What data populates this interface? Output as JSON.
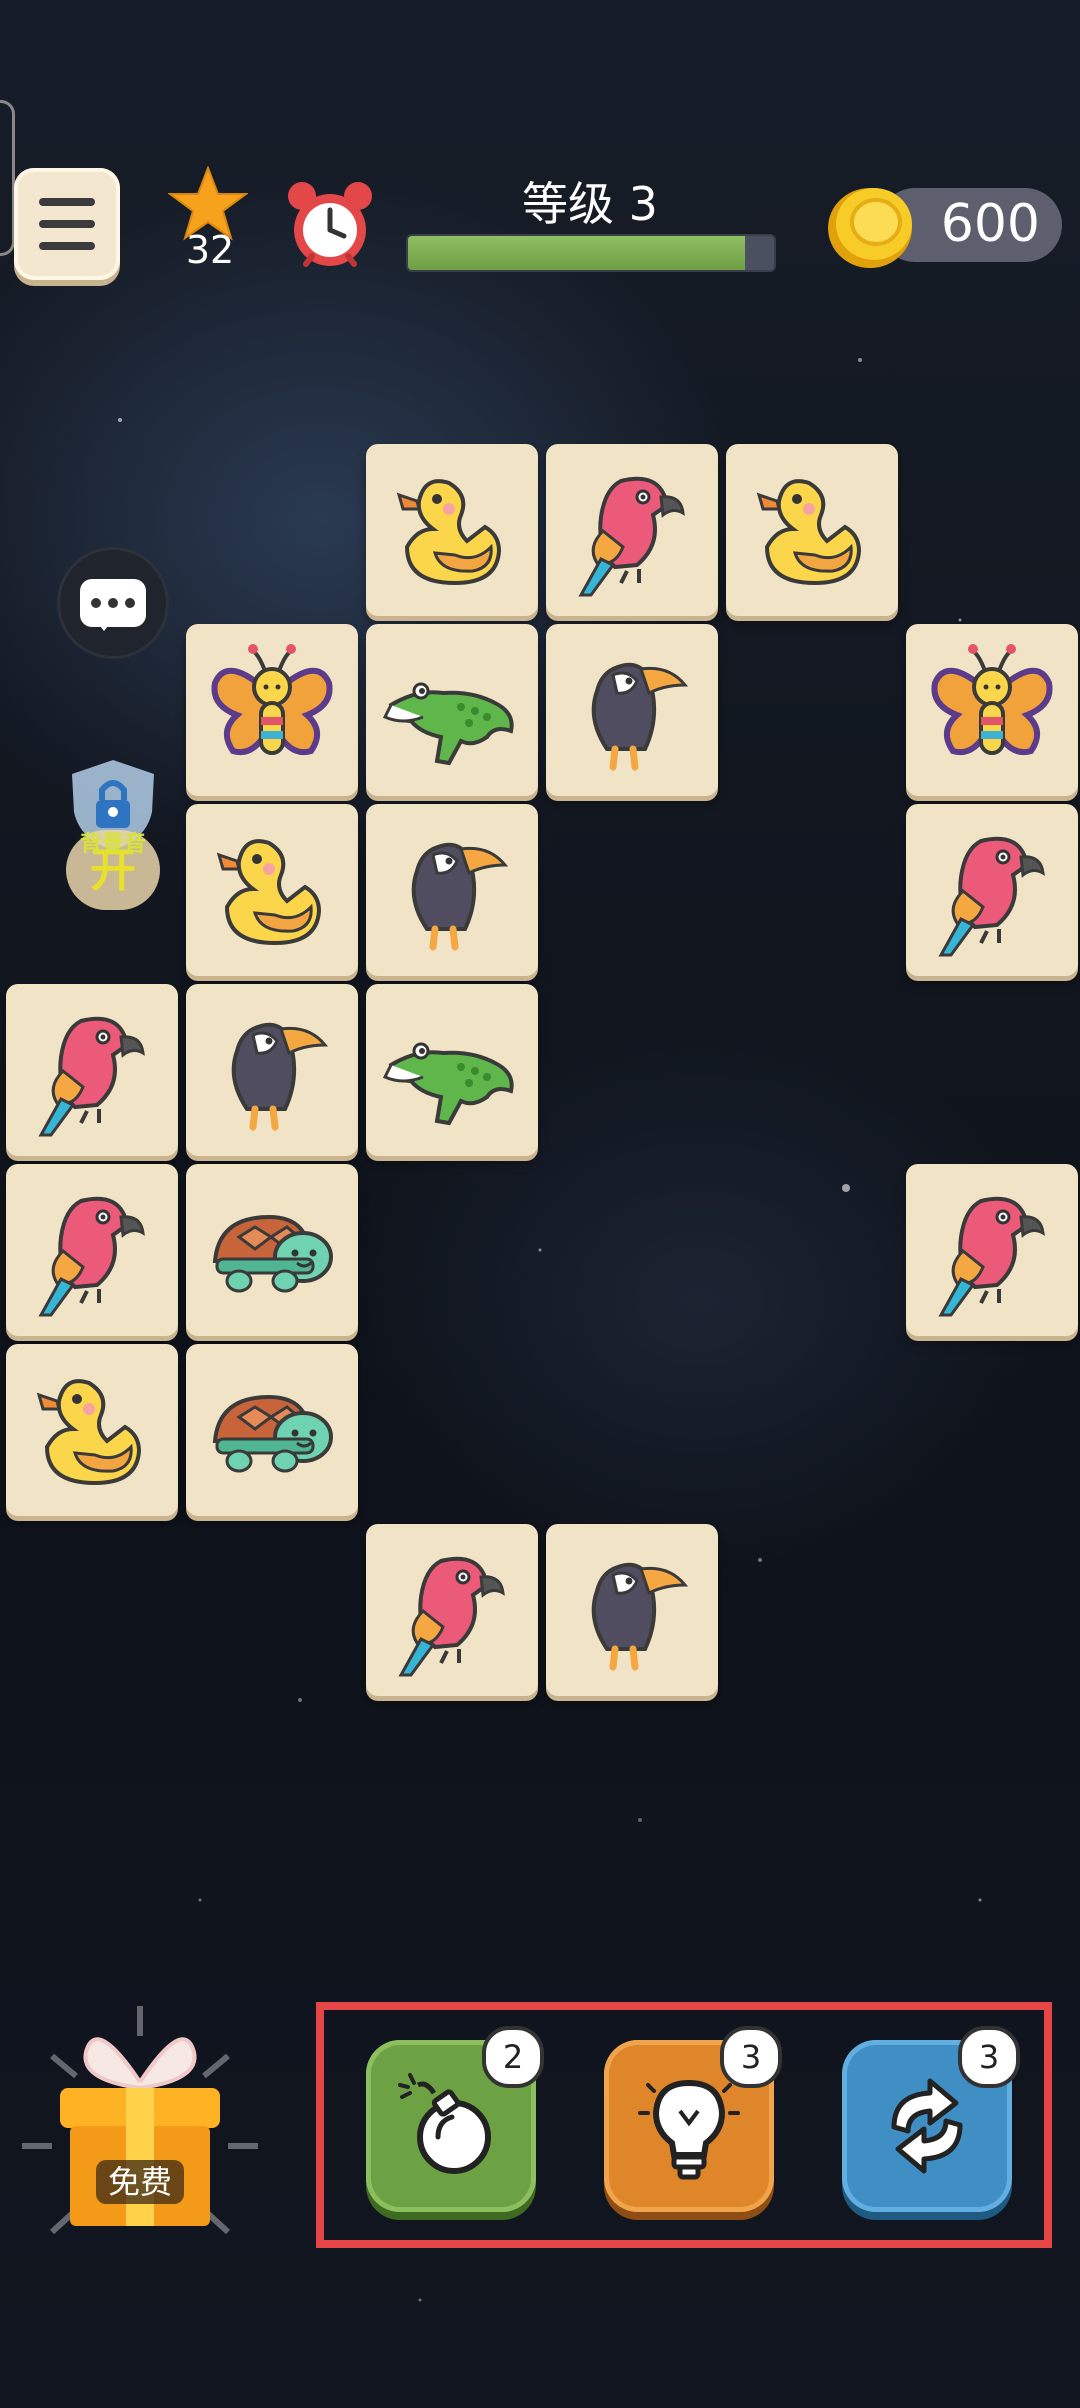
{
  "topbar": {
    "stars": "32",
    "level_title": "等级 3",
    "level_progress": 0.92,
    "coins": "600"
  },
  "side": {
    "bgm_label": "背景音",
    "bgm_toggle": "开"
  },
  "tiles": [
    {
      "row": 0,
      "col": 2,
      "animal": "duck"
    },
    {
      "row": 0,
      "col": 3,
      "animal": "parrot"
    },
    {
      "row": 0,
      "col": 4,
      "animal": "duck"
    },
    {
      "row": 1,
      "col": 1,
      "animal": "butterfly"
    },
    {
      "row": 1,
      "col": 2,
      "animal": "crocodile"
    },
    {
      "row": 1,
      "col": 3,
      "animal": "toucan"
    },
    {
      "row": 1,
      "col": 5,
      "animal": "butterfly"
    },
    {
      "row": 2,
      "col": 1,
      "animal": "duck"
    },
    {
      "row": 2,
      "col": 2,
      "animal": "toucan"
    },
    {
      "row": 2,
      "col": 5,
      "animal": "parrot"
    },
    {
      "row": 3,
      "col": 0,
      "animal": "parrot"
    },
    {
      "row": 3,
      "col": 1,
      "animal": "toucan"
    },
    {
      "row": 3,
      "col": 2,
      "animal": "crocodile"
    },
    {
      "row": 4,
      "col": 0,
      "animal": "parrot"
    },
    {
      "row": 4,
      "col": 1,
      "animal": "turtle"
    },
    {
      "row": 4,
      "col": 5,
      "animal": "parrot"
    },
    {
      "row": 5,
      "col": 0,
      "animal": "duck"
    },
    {
      "row": 5,
      "col": 1,
      "animal": "turtle"
    },
    {
      "row": 6,
      "col": 2,
      "animal": "parrot"
    },
    {
      "row": 6,
      "col": 3,
      "animal": "toucan"
    }
  ],
  "tools": {
    "bomb_count": "2",
    "hint_count": "3",
    "shuffle_count": "3"
  },
  "gift": {
    "label": "免费"
  },
  "colors": {
    "tile": "#f0e3c6",
    "bomb": "#6da244",
    "hint": "#e0862a",
    "shuffle": "#3f8fc4",
    "highlight": "#e54545"
  }
}
